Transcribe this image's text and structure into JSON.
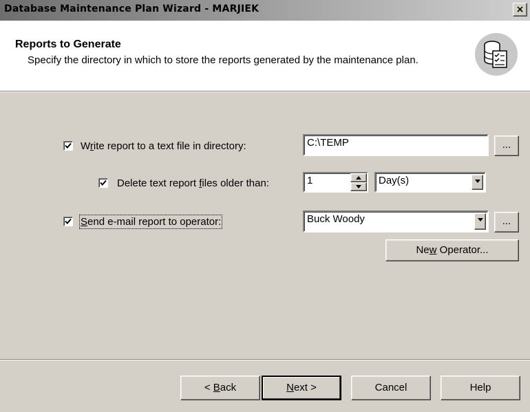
{
  "window": {
    "title": "Database Maintenance Plan Wizard - MARJIEK",
    "close": "×"
  },
  "header": {
    "title": "Reports to Generate",
    "description": "Specify the directory in which to store the reports generated by the maintenance plan."
  },
  "options": {
    "write_report": {
      "checked": true,
      "pre": "W",
      "mnemonic": "r",
      "post": "ite report to a text file in directory:",
      "value": "C:\\TEMP",
      "browse": "..."
    },
    "delete_old": {
      "checked": true,
      "pre": "Delete text report ",
      "mnemonic": "f",
      "post": "iles older than:",
      "number": "1",
      "unit": "Day(s)"
    },
    "send_email": {
      "checked": true,
      "pre": "",
      "mnemonic": "S",
      "post": "end e-mail report to operator:",
      "operator": "Buck Woody",
      "browse": "..."
    },
    "new_operator": {
      "pre": "Ne",
      "mnemonic": "w",
      "post": " Operator..."
    }
  },
  "footer": {
    "back": {
      "pre": "< ",
      "mnemonic": "B",
      "post": "ack"
    },
    "next": {
      "pre": "",
      "mnemonic": "N",
      "post": "ext >"
    },
    "cancel": "Cancel",
    "help": "Help"
  }
}
